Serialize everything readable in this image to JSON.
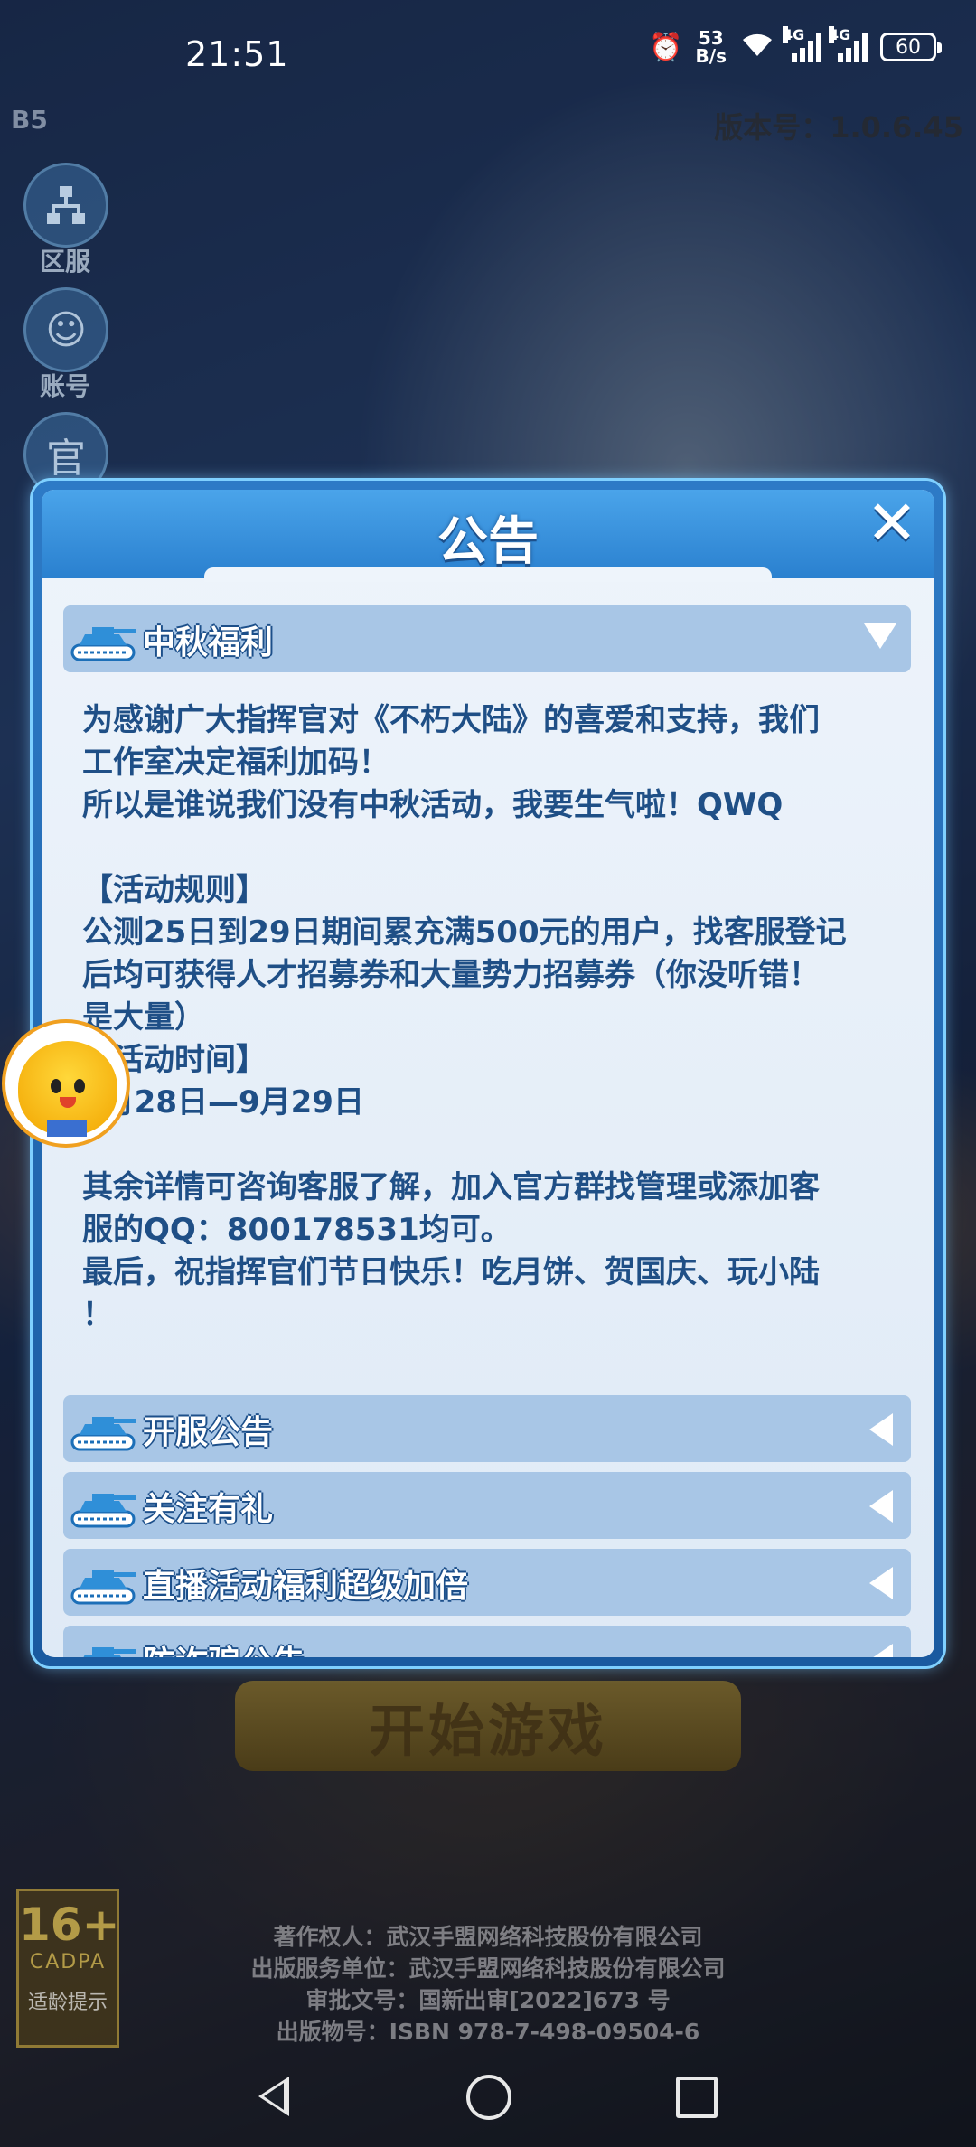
{
  "status_bar": {
    "time": "21:51",
    "net_speed_value": "53",
    "net_speed_unit": "B/s",
    "signal1_label": "4G",
    "signal2_label": "4G",
    "battery": "60"
  },
  "game": {
    "server_code": "B5",
    "version": "版本号：1.0.6.45",
    "side_buttons": [
      {
        "label": "区服",
        "icon": "server-icon"
      },
      {
        "label": "账号",
        "icon": "account-smiley-icon"
      },
      {
        "label": "",
        "icon": "official-icon"
      }
    ],
    "side3_glyph": "官",
    "start_button": "开始游戏",
    "age_rating": {
      "number": "16+",
      "org": "CADPA",
      "hint": "适龄提示"
    },
    "copyright_lines": [
      "著作权人：武汉手盟网络科技股份有限公司",
      "出版服务单位：武汉手盟网络科技股份有限公司",
      "审批文号：国新出审[2022]673 号",
      "出版物号：ISBN 978-7-498-09504-6"
    ]
  },
  "modal": {
    "title": "公告",
    "close_glyph": "✕",
    "sections": [
      {
        "title": "中秋福利",
        "expanded": true
      },
      {
        "title": "开服公告",
        "expanded": false
      },
      {
        "title": "关注有礼",
        "expanded": false
      },
      {
        "title": "直播活动福利超级加倍",
        "expanded": false
      },
      {
        "title": "防诈骗公告",
        "expanded": false
      }
    ],
    "content_lines": [
      "为感谢广大指挥官对《不朽大陆》的喜爱和支持，我们",
      "工作室决定福利加码！",
      "所以是谁说我们没有中秋活动，我要生气啦！QWQ",
      "",
      "【活动规则】",
      "公测25日到29日期间累充满500元的用户，找客服登记",
      "后均可获得人才招募券和大量势力招募券（你没听错！",
      "是大量）",
      "【活动时间】",
      "9月28日—9月29日",
      "",
      "其余详情可咨询客服了解，加入官方群找管理或添加客",
      "服的QQ：800178531均可。",
      "最后，祝指挥官们节日快乐！吃月饼、贺国庆、玩小陆",
      "！"
    ]
  },
  "colors": {
    "modal_border": "#7fd0ff",
    "title_bar": "#2a80cf",
    "section_header": "#a8c6e6",
    "content_text": "#1f4f86"
  }
}
